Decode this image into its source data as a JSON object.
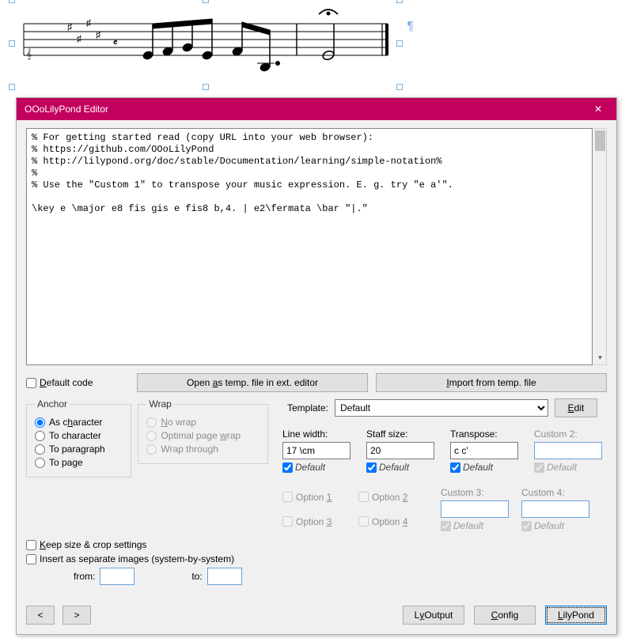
{
  "notation_pilcrow": "¶",
  "dialog": {
    "title": "OOoLilyPond Editor",
    "close_glyph": "✕",
    "editor_text": "% For getting started read (copy URL into your web browser):\n% https://github.com/OOoLilyPond\n% http://lilypond.org/doc/stable/Documentation/learning/simple-notation%\n%\n% Use the \"Custom 1\" to transpose your music expression. E. g. try \"e a'\".\n\n\\key e \\major e8 fis gis e fis8 b,4. | e2\\fermata \\bar \"|.\"",
    "scroll_down": "▾",
    "default_code_label": "Default code",
    "open_temp_label": "Open as temp. file in ext. editor",
    "import_temp_label": "Import from temp. file",
    "anchor": {
      "legend": "Anchor",
      "as_char": "As character",
      "to_char": "To character",
      "to_para": "To paragraph",
      "to_page": "To page"
    },
    "wrap": {
      "legend": "Wrap",
      "no_wrap": "No wrap",
      "optimal": "Optimal page wrap",
      "through": "Wrap through"
    },
    "template_label": "Template:",
    "template_value": "Default",
    "edit_label": "Edit",
    "params": {
      "linewidth_label": "Line width:",
      "linewidth_value": "17 \\cm",
      "staffsize_label": "Staff size:",
      "staffsize_value": "20",
      "transpose_label": "Transpose:",
      "transpose_value": "c c'",
      "custom2_label": "Custom 2:",
      "custom2_value": "",
      "default_label": "Default"
    },
    "keep_size_label": "Keep size & crop settings",
    "insert_sep_label": "Insert as separate images (system-by-system)",
    "from_label": "from:",
    "to_label": "to:",
    "from_value": "",
    "to_value": "",
    "options": {
      "opt1": "Option 1",
      "opt2": "Option 2",
      "opt3": "Option 3",
      "opt4": "Option 4"
    },
    "custom34": {
      "c3_label": "Custom 3:",
      "c3_value": "",
      "c4_label": "Custom 4:",
      "c4_value": ""
    },
    "nav_prev": "<",
    "nav_next": ">",
    "ly_output": "Ly Output",
    "config": "Config",
    "lilypond": "LilyPond"
  }
}
